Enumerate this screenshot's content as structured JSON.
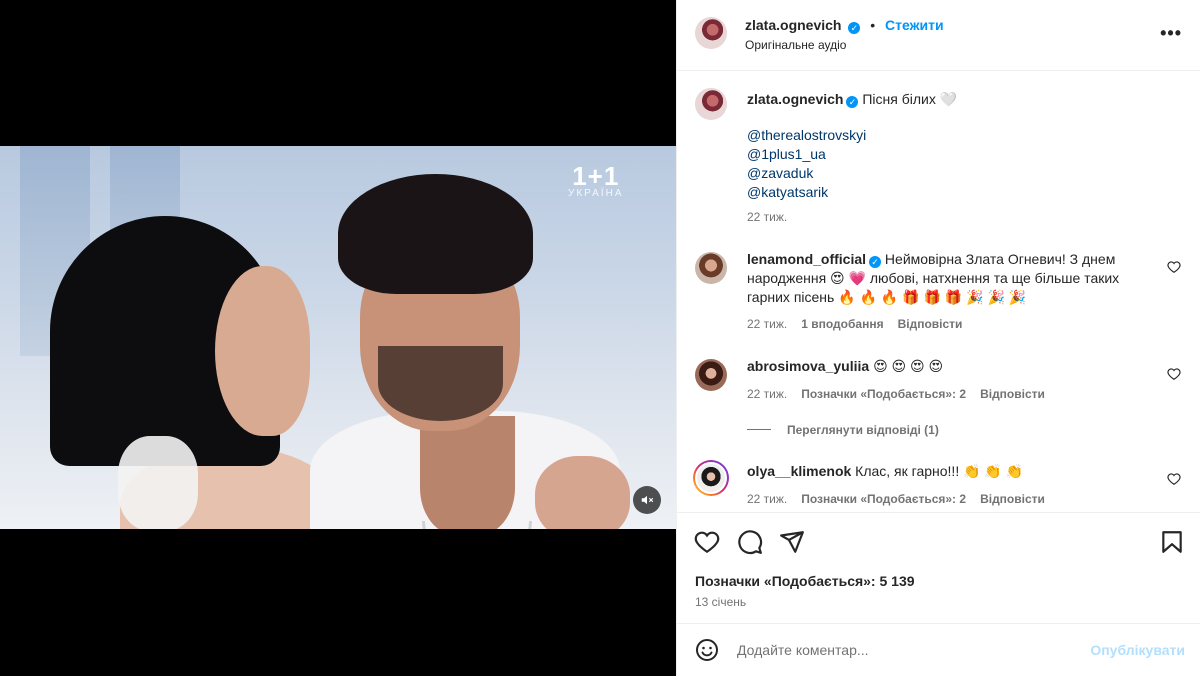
{
  "post": {
    "author": "zlata.ognevich",
    "follow_label": "Стежити",
    "bullet": "•",
    "audio": "Оригінальне аудіо",
    "more_label": "•••"
  },
  "video": {
    "channel_logo": "1+1",
    "channel_sub": "УКРАЇНА",
    "mute_icon": "speaker-muted-icon"
  },
  "caption": {
    "author": "zlata.ognevich",
    "text": "Пісня білих 🤍",
    "mentions": [
      "@therealostrovskyi",
      "@1plus1_ua",
      "@zavaduk",
      "@katyatsarik"
    ],
    "time": "22 тиж."
  },
  "comments": [
    {
      "author": "lenamond_official",
      "verified": true,
      "text": "Неймовірна Злата Огневич! З днем народження 😍 💗 любові, натхнення та ще більше таких гарних пісень 🔥 🔥 🔥 🎁 🎁 🎁 🎉 🎉 🎉",
      "time": "22 тиж.",
      "likes": "1 вподобання",
      "reply": "Відповісти"
    },
    {
      "author": "abrosimova_yuliia",
      "verified": false,
      "text": "😍 😍 😍 😍",
      "time": "22 тиж.",
      "likes": "Позначки «Подобається»: 2",
      "reply": "Відповісти",
      "view_replies": "Переглянути відповіді (1)"
    },
    {
      "author": "olya__klimenok",
      "verified": false,
      "text": "Клас, як гарно!!! 👏 👏 👏",
      "time": "22 тиж.",
      "likes": "Позначки «Подобається»: 2",
      "reply": "Відповісти"
    }
  ],
  "stats": {
    "likes": "Позначки «Подобається»: 5 139",
    "date": "13 січень"
  },
  "composer": {
    "placeholder": "Додайте коментар...",
    "post_label": "Опублікувати"
  },
  "colors": {
    "accent": "#0095f6",
    "link": "#00376b",
    "muted": "#737373",
    "post_disabled": "#b2dffc"
  }
}
